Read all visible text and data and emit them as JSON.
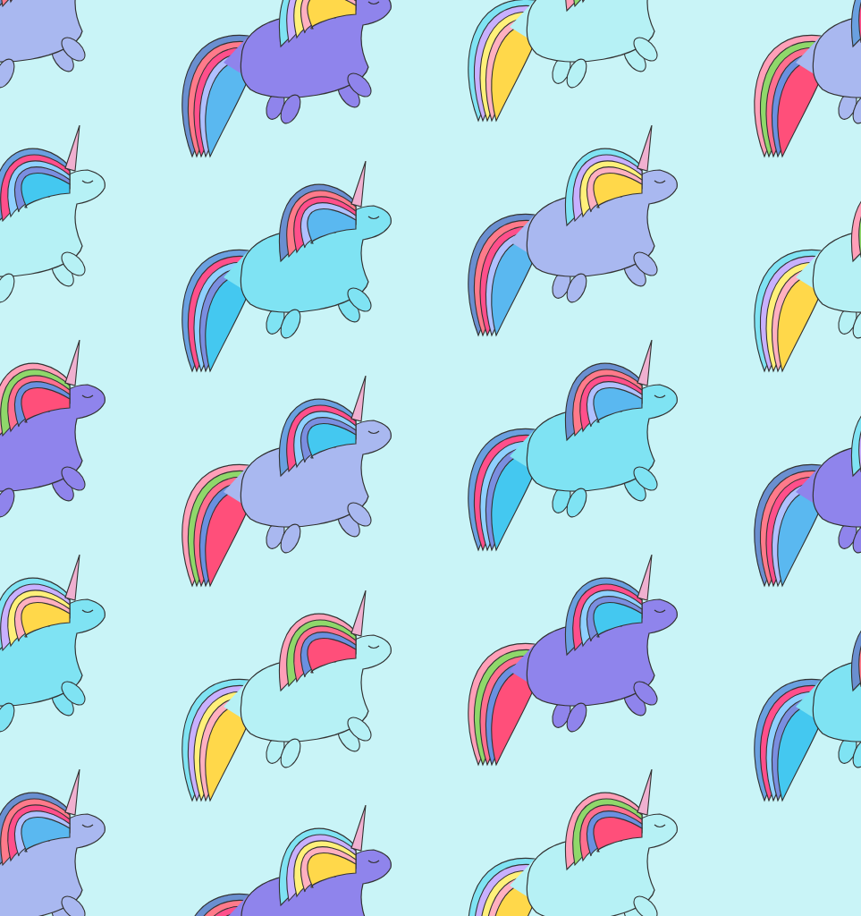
{
  "pattern": {
    "columns": [
      {
        "unicorns": [
          {
            "color": "#a9b8f0"
          },
          {
            "color": "#b6f1f5"
          },
          {
            "color": "#8f84ec"
          },
          {
            "color": "#7fe3f3"
          },
          {
            "color": "#a9b8f0"
          }
        ]
      },
      {
        "unicorns": [
          {
            "color": "#8f84ec"
          },
          {
            "color": "#7fe3f3"
          },
          {
            "color": "#a9b8f0"
          },
          {
            "color": "#b6f1f5"
          },
          {
            "color": "#8f84ec"
          }
        ]
      },
      {
        "unicorns": [
          {
            "color": "#b6f1f5"
          },
          {
            "color": "#a9b8f0"
          },
          {
            "color": "#7fe3f3"
          },
          {
            "color": "#8f84ec"
          },
          {
            "color": "#b6f1f5"
          }
        ]
      },
      {
        "unicorns": [
          {
            "color": "#a9b8f0"
          },
          {
            "color": "#b6f1f5"
          },
          {
            "color": "#8f84ec"
          },
          {
            "color": "#7fe3f3"
          }
        ]
      }
    ]
  }
}
